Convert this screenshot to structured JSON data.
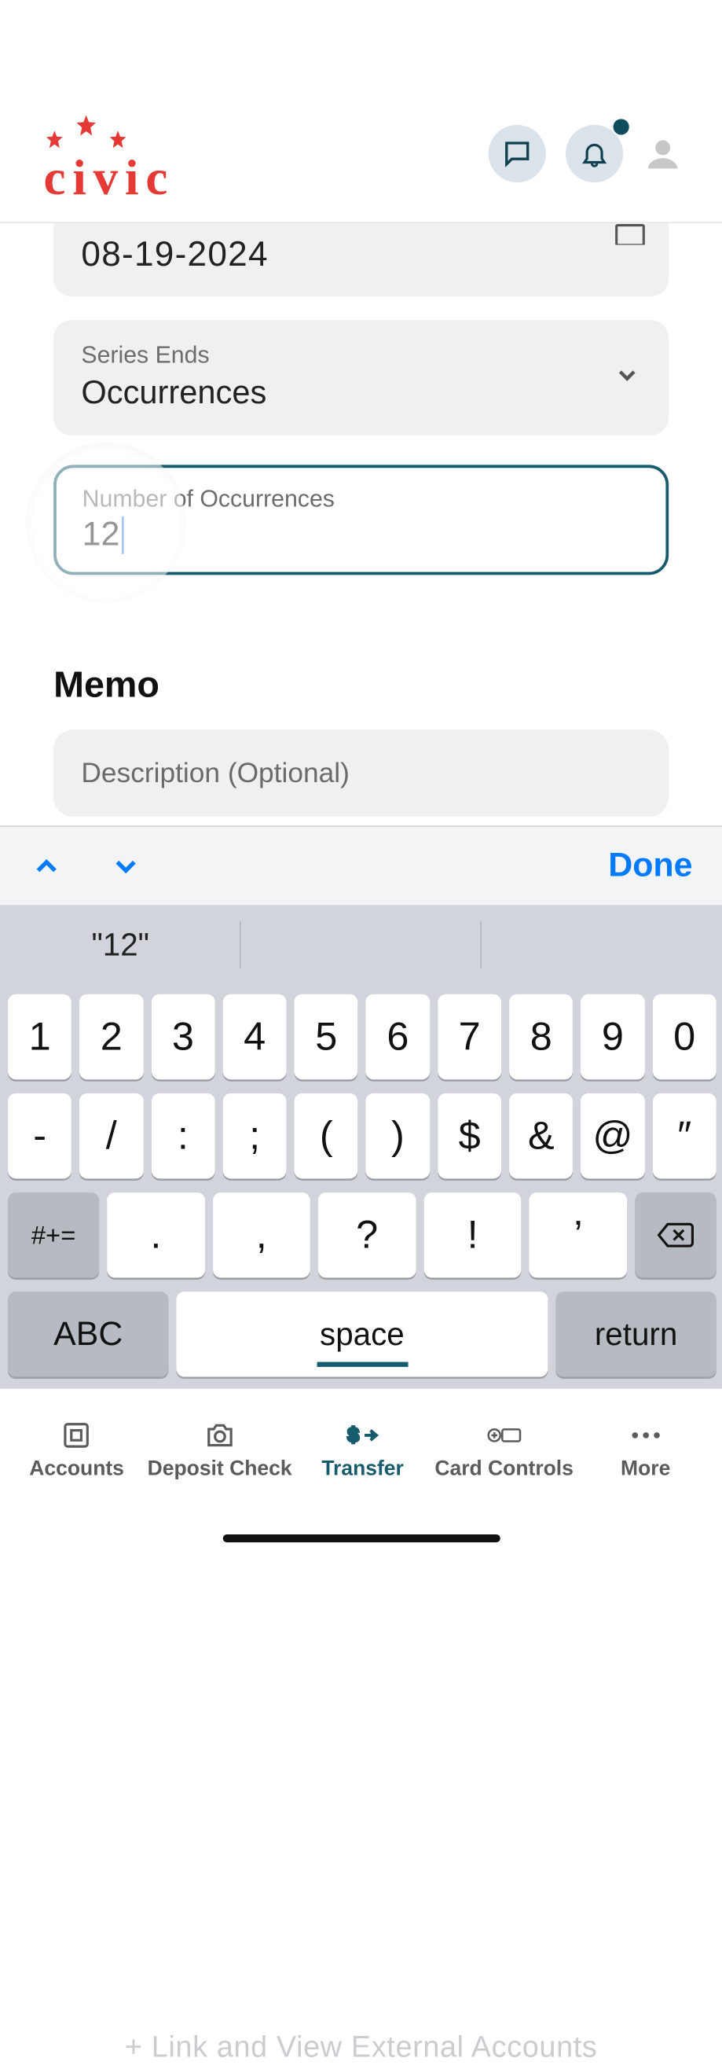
{
  "header": {
    "logo_text": "civic"
  },
  "form": {
    "date_value": "08-19-2024",
    "series_ends": {
      "label": "Series Ends",
      "value": "Occurrences"
    },
    "occurrences": {
      "label": "Number of Occurrences",
      "value": "12"
    },
    "memo": {
      "title": "Memo",
      "placeholder": "Description (Optional)"
    }
  },
  "keyboard": {
    "done": "Done",
    "suggestion": "\"12\"",
    "row1": [
      "1",
      "2",
      "3",
      "4",
      "5",
      "6",
      "7",
      "8",
      "9",
      "0"
    ],
    "row2": [
      "-",
      "/",
      ":",
      ";",
      "(",
      ")",
      "$",
      "&",
      "@",
      "″"
    ],
    "row3_syms": [
      ".",
      ",",
      "?",
      "!",
      "’"
    ],
    "symshift": "#+=",
    "abc": "ABC",
    "space": "space",
    "return": "return",
    "ghost": "+   Link and View External Accounts"
  },
  "tabs": {
    "accounts": "Accounts",
    "deposit": "Deposit Check",
    "transfer": "Transfer",
    "card": "Card Controls",
    "more": "More"
  }
}
